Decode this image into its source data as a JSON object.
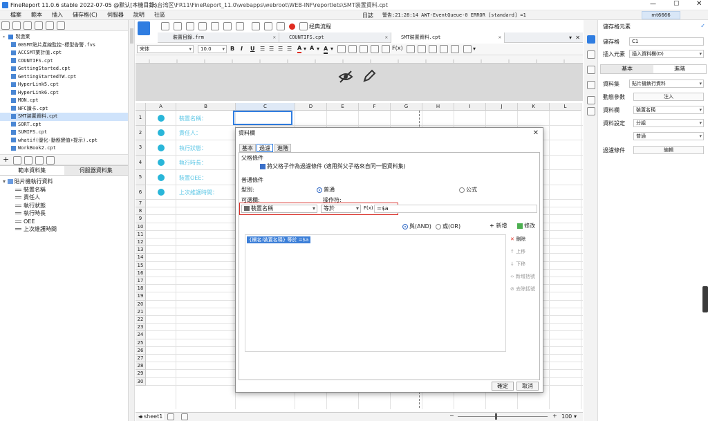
{
  "titlebar": {
    "title": "FineReport 11.0.6 stable 2022-07-05 @默认[本機目錄]",
    "path": "D:\\台湾区\\FR11\\FineReport_11.0\\webapps\\webroot\\WEB-INF\\reportlets\\SMT装置資料.cpt"
  },
  "menu": {
    "items": [
      "檔案",
      "範本",
      "插入",
      "儲存格(C)",
      "伺服器",
      "說明",
      "社區"
    ],
    "log_label": "日誌",
    "status_text": "警告:21:28:14 AWT-EventQueue-0 ERROR [standard] =1",
    "user": "mt6666"
  },
  "left_tree": {
    "root": "製造業",
    "items": [
      "00SMT貼片產線監控-標型告警.fvs",
      "ACCSMT業計值.cpt",
      "COUNTIFS.cpt",
      "GettingStarted.cpt",
      "GettingStartedTW.cpt",
      "HyperLink5.cpt",
      "HyperLink6.cpt",
      "MON.cpt",
      "NFC讀卡.cpt",
      "SMT装置資料.cpt",
      "SORT.cpt",
      "SUMIFS.cpt",
      "whatif(優化-動態變值+提示).cpt",
      "WorkBook2.cpt"
    ],
    "selected_index": 9
  },
  "dataset_panel": {
    "tabs": [
      "範本資料集",
      "伺服器資料集"
    ],
    "dataset_name": "貼片機執行資料",
    "fields": [
      "裝置名稱",
      "責任人",
      "執行狀態",
      "執行時長",
      "OEE",
      "上次維護時間"
    ]
  },
  "toolbar": {
    "tpl_label": "经典流程"
  },
  "file_tabs": [
    "裝置目錄.frm",
    "COUNTIFS.cpt",
    "SMT裝置資料.cpt"
  ],
  "format_bar": {
    "font": "宋体",
    "size": "10.0"
  },
  "grid": {
    "columns": [
      "A",
      "B",
      "C",
      "D",
      "E",
      "F",
      "G",
      "H",
      "I",
      "J",
      "K",
      "L"
    ],
    "rows": [
      "1",
      "2",
      "3",
      "4",
      "5",
      "6",
      "7",
      "8",
      "9",
      "10",
      "11",
      "12",
      "13",
      "14",
      "15",
      "16",
      "17",
      "18",
      "19",
      "20",
      "21",
      "22",
      "23",
      "24",
      "25",
      "26",
      "27",
      "28",
      "29",
      "30"
    ],
    "labels": [
      "裝置名稱：",
      "責任人：",
      "執行狀態：",
      "執行時長：",
      "裝置OEE：",
      "上次維護時間："
    ]
  },
  "sheet": {
    "name": "sheet1",
    "zoom": "100"
  },
  "right_panel": {
    "title": "儲存格元素",
    "cell_label": "儲存格",
    "cell_value": "C1",
    "insert_label": "插入元素",
    "insert_value": "插入資料欄(D)",
    "tabs": [
      "基本",
      "進階"
    ],
    "dataset_label": "資料集",
    "dataset_value": "貼片機執行資料",
    "params_label": "動態參數",
    "params_btn": "注入",
    "column_label": "資料欄",
    "column_value": "裝置名稱",
    "setting_label": "資料設定",
    "setting_value": "分組",
    "setting_sub": "普通",
    "filter_label": "過濾條件",
    "filter_btn": "編輯"
  },
  "dialog": {
    "title": "資料欄",
    "tabs": [
      "基本",
      "過濾",
      "進階"
    ],
    "parent_section": "父格條件",
    "parent_checkbox": "將父格子作為過濾條件 (適用與父子格來自同一個資料集)",
    "normal_section": "普通條件",
    "type_label": "型別:",
    "type_normal": "普通",
    "type_formula": "公式",
    "field_label": "可選欄:",
    "operator_label": "操作符:",
    "field_value": "裝置名稱",
    "operator_value": "等於",
    "value_text": "=$a",
    "and_label": "與(AND)",
    "or_label": "或(OR)",
    "add_btn": "新增",
    "modify_btn": "修改",
    "condition_item": "{欄名:裝置名稱} 等於  =$a",
    "delete_btn": "刪除",
    "up_btn": "上移",
    "down_btn": "下移",
    "add_bracket_btn": "新增括號",
    "remove_bracket_btn": "去除括號",
    "ok_btn": "確定",
    "cancel_btn": "取消"
  }
}
